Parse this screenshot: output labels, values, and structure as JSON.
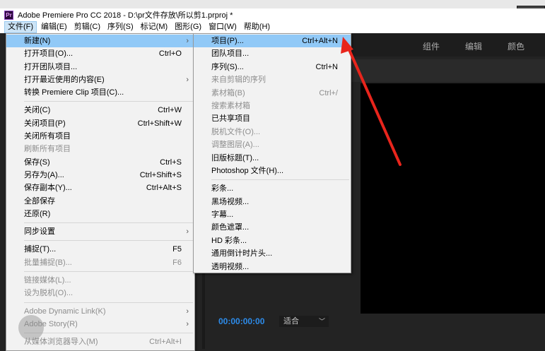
{
  "window": {
    "title": "Adobe Premiere Pro CC 2018 - D:\\pr文件存放\\所以剪1.prproj *",
    "logo": "Pr"
  },
  "menubar": [
    "文件(F)",
    "编辑(E)",
    "剪辑(C)",
    "序列(S)",
    "标记(M)",
    "图形(G)",
    "窗口(W)",
    "帮助(H)"
  ],
  "file_menu": [
    {
      "label": "新建(N)",
      "submenu": true,
      "highlight": true
    },
    {
      "label": "打开项目(O)...",
      "shortcut": "Ctrl+O"
    },
    {
      "label": "打开团队项目..."
    },
    {
      "label": "打开最近使用的内容(E)",
      "submenu": true
    },
    {
      "label": "转换 Premiere Clip 项目(C)..."
    },
    {
      "sep": true
    },
    {
      "label": "关闭(C)",
      "shortcut": "Ctrl+W"
    },
    {
      "label": "关闭项目(P)",
      "shortcut": "Ctrl+Shift+W"
    },
    {
      "label": "关闭所有项目"
    },
    {
      "label": "刷新所有项目",
      "disabled": true
    },
    {
      "label": "保存(S)",
      "shortcut": "Ctrl+S"
    },
    {
      "label": "另存为(A)...",
      "shortcut": "Ctrl+Shift+S"
    },
    {
      "label": "保存副本(Y)...",
      "shortcut": "Ctrl+Alt+S"
    },
    {
      "label": "全部保存"
    },
    {
      "label": "还原(R)"
    },
    {
      "sep": true
    },
    {
      "label": "同步设置",
      "submenu": true
    },
    {
      "sep": true
    },
    {
      "label": "捕捉(T)...",
      "shortcut": "F5"
    },
    {
      "label": "批量捕捉(B)...",
      "shortcut": "F6",
      "disabled": true
    },
    {
      "sep": true
    },
    {
      "label": "链接媒体(L)...",
      "disabled": true
    },
    {
      "label": "设为脱机(O)...",
      "disabled": true
    },
    {
      "sep": true
    },
    {
      "label": "Adobe Dynamic Link(K)",
      "submenu": true,
      "disabled": true
    },
    {
      "label": "Adobe Story(R)",
      "submenu": true,
      "disabled": true
    },
    {
      "sep": true
    },
    {
      "label": "从媒体浏览器导入(M)",
      "shortcut": "Ctrl+Alt+I",
      "disabled": true
    }
  ],
  "new_submenu": [
    {
      "label": "项目(P)...",
      "shortcut": "Ctrl+Alt+N",
      "highlight": true
    },
    {
      "label": "团队项目..."
    },
    {
      "label": "序列(S)...",
      "shortcut": "Ctrl+N"
    },
    {
      "label": "来自剪辑的序列",
      "disabled": true
    },
    {
      "label": "素材箱(B)",
      "shortcut": "Ctrl+/",
      "disabled": true
    },
    {
      "label": "搜索素材箱",
      "disabled": true
    },
    {
      "label": "已共享项目"
    },
    {
      "label": "脱机文件(O)...",
      "disabled": true
    },
    {
      "label": "调整图层(A)...",
      "disabled": true
    },
    {
      "label": "旧版标题(T)..."
    },
    {
      "label": "Photoshop 文件(H)..."
    },
    {
      "sep": true
    },
    {
      "label": "彩条..."
    },
    {
      "label": "黑场视频..."
    },
    {
      "label": "字幕..."
    },
    {
      "label": "颜色遮罩..."
    },
    {
      "label": "HD 彩条..."
    },
    {
      "label": "通用倒计时片头..."
    },
    {
      "label": "透明视频..."
    }
  ],
  "workspace_tabs": [
    "组件",
    "编辑",
    "颜色"
  ],
  "monitor": {
    "timecode": "00:00:00:00",
    "fit": "适合"
  },
  "colors": {
    "highlight": "#91c9f7",
    "timecode": "#2d8ceb",
    "arrow": "#e8251c"
  }
}
